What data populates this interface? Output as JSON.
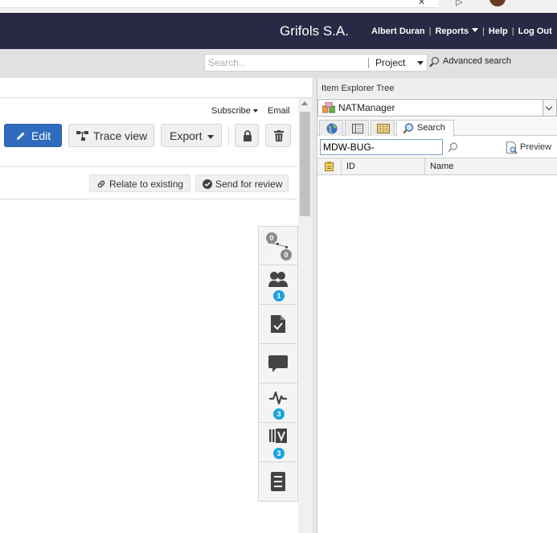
{
  "header": {
    "company": "Grifols S.A.",
    "user": "Albert Duran",
    "reports": "Reports",
    "help": "Help",
    "logout": "Log Out",
    "sep": "|"
  },
  "search": {
    "placeholder": "Search...",
    "scope": "Project",
    "advanced": "Advanced search"
  },
  "item": {
    "subscribe": "Subscribe",
    "email": "Email",
    "edit": "Edit",
    "trace_view": "Trace view",
    "export": "Export",
    "relate": "Relate to existing",
    "send_review": "Send for review"
  },
  "rail": {
    "badges": {
      "relationships_top": "0",
      "relationships_bottom": "0",
      "collaborators": "1",
      "activity": "3",
      "versions": "3"
    }
  },
  "explorer": {
    "title": "Item Explorer Tree",
    "project": "NATManager",
    "search_tab": "Search",
    "query": "MDW-BUG-",
    "preview": "Preview",
    "columns": [
      "ID",
      "Name"
    ]
  },
  "colors": {
    "header_bg": "#282a45",
    "primary_button": "#2f6bbf",
    "badge_blue": "#1ba1e2",
    "badge_gray": "#8a8a8a"
  }
}
